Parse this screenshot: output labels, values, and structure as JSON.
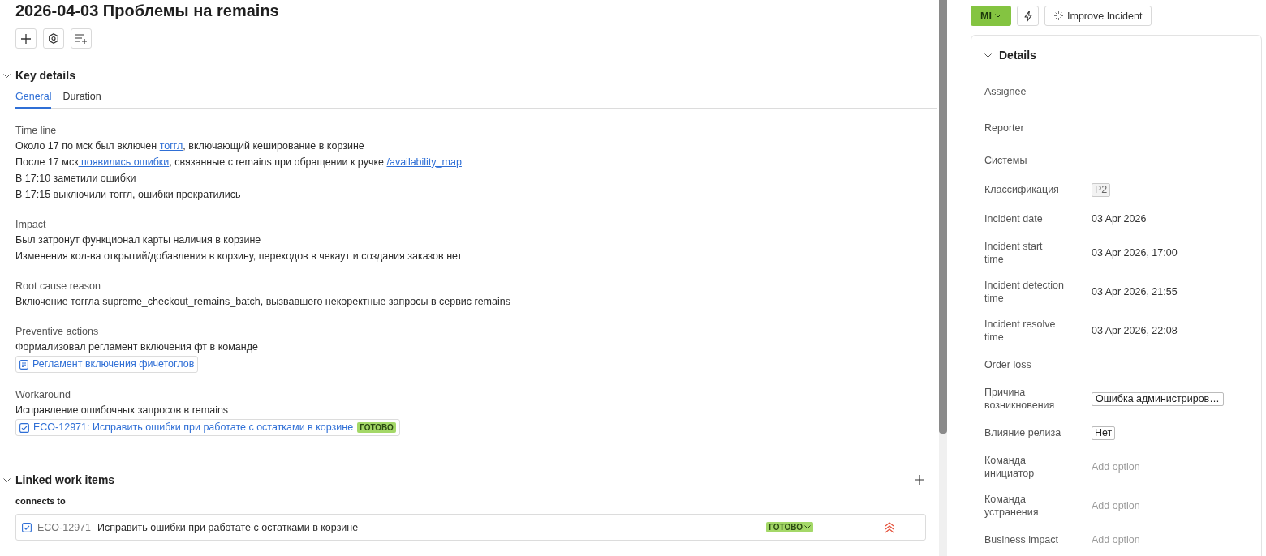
{
  "title": "2026-04-03 Проблемы на remains",
  "key_details": {
    "heading": "Key details",
    "expanded": true,
    "tabs": [
      {
        "label": "General",
        "selected": true
      },
      {
        "label": "Duration",
        "selected": false
      }
    ],
    "sections": [
      {
        "label": "Time line",
        "lines": [
          [
            {
              "text": "Около 17 по мск был включен ",
              "link": false
            },
            {
              "text": "тоггл",
              "link": true
            },
            {
              "text": ", включающий кеширование в корзине",
              "link": false
            }
          ],
          [
            {
              "text": "После 17 мск",
              "link": false
            },
            {
              "text": " появились ошибки",
              "link": true
            },
            {
              "text": ", связанные с remains при обращении к ручке ",
              "link": false
            },
            {
              "text": "/availability_map",
              "link": true
            }
          ],
          [
            {
              "text": "В 17:10 заметили ошибки",
              "link": false
            }
          ],
          [
            {
              "text": "В 17:15 выключили тоггл, ошибки прекратились",
              "link": false
            }
          ]
        ]
      },
      {
        "label": "Impact",
        "lines": [
          [
            {
              "text": "Был затронут функционал карты наличия в корзине",
              "link": false
            }
          ],
          [
            {
              "text": "Изменения кол-ва открытий/добавления в корзину, переходов в чекаут и создания заказов нет",
              "link": false
            }
          ]
        ]
      },
      {
        "label": "Root cause reason",
        "lines": [
          [
            {
              "text": "Включение тоггла supreme_checkout_remains_batch, вызвавшего некоректные запросы в сервис remains",
              "link": false
            }
          ]
        ]
      },
      {
        "label": "Preventive actions",
        "lines": [
          [
            {
              "text": "Формализовал регламент включения фт в команде",
              "link": false
            }
          ]
        ],
        "attachments": [
          {
            "kind": "page",
            "title": "Регламент включения фичетоглов"
          }
        ]
      },
      {
        "label": "Workaround",
        "lines": [
          [
            {
              "text": "Исправление ошибочных запросов в remains",
              "link": false
            }
          ]
        ],
        "attachments": [
          {
            "kind": "work_item",
            "title": "ECO-12971: Исправить ошибки при работате с остатками в корзине",
            "status": "ГОТОВО"
          }
        ]
      }
    ]
  },
  "linked": {
    "heading": "Linked work items",
    "expanded": true,
    "groups": [
      {
        "label": "connects to",
        "items": [
          {
            "key": "ECO-12971",
            "title": "Исправить ошибки при работате с остатками в корзине",
            "done": true,
            "status": "ГОТОВО"
          }
        ]
      }
    ]
  },
  "side": {
    "status_button": "MI",
    "improve_button": "Improve Incident",
    "details": {
      "heading": "Details",
      "expanded": true,
      "fields": [
        {
          "label": "Assignee",
          "kind": "user"
        },
        {
          "label": "Reporter",
          "kind": "user"
        },
        {
          "label": "Системы"
        },
        {
          "label": "Классификация",
          "kind": "tag",
          "value": "P2"
        },
        {
          "label": "Incident date",
          "kind": "text",
          "value": "03 Apr 2026"
        },
        {
          "label": "Incident start time",
          "kind": "text",
          "value": "03 Apr 2026, 17:00"
        },
        {
          "label": "Incident detection time",
          "kind": "text",
          "value": "03 Apr 2026, 21:55"
        },
        {
          "label": "Incident resolve time",
          "kind": "text",
          "value": "03 Apr 2026, 22:08"
        },
        {
          "label": "Order loss"
        },
        {
          "label": "Причина возникновения",
          "kind": "select",
          "value": "Ошибка администриров…"
        },
        {
          "label": "Влияние релиза",
          "kind": "chip",
          "value": "Нет"
        },
        {
          "label": "Команда инициатор",
          "kind": "option",
          "placeholder": "Add option"
        },
        {
          "label": "Команда устранения",
          "kind": "option",
          "placeholder": "Add option"
        },
        {
          "label": "Business impact",
          "kind": "option",
          "placeholder": "Add option"
        }
      ]
    }
  }
}
